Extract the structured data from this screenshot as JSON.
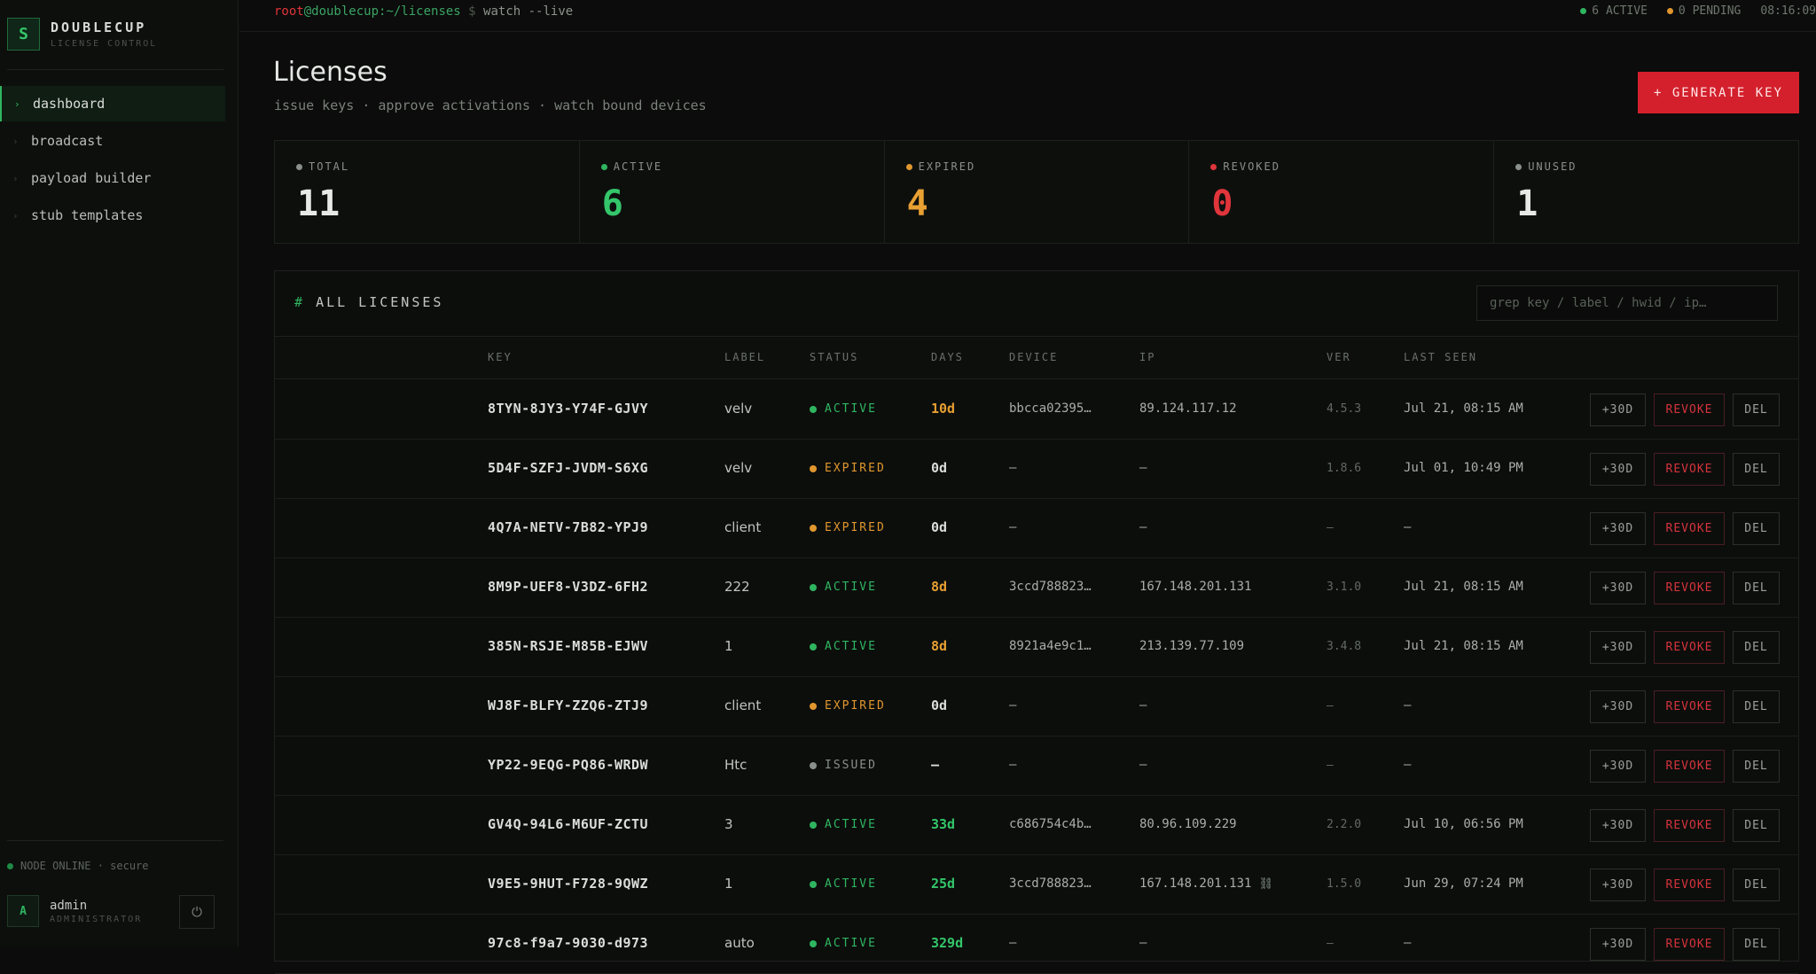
{
  "brand": {
    "logo": "S",
    "name": "DOUBLECUP",
    "sub": "LICENSE CONTROL"
  },
  "nav": [
    {
      "label": "dashboard",
      "active": true
    },
    {
      "label": "broadcast",
      "active": false
    },
    {
      "label": "payload builder",
      "active": false
    },
    {
      "label": "stub templates",
      "active": false
    }
  ],
  "node_status": "NODE ONLINE · secure",
  "user": {
    "initial": "A",
    "name": "admin",
    "role": "ADMINISTRATOR",
    "logout_icon": "power-icon"
  },
  "topbar": {
    "cmd_user": "root",
    "cmd_host": "@doublecup",
    "cmd_path": ":~/licenses",
    "cmd_prompt": " $ ",
    "cmd_text": "watch --live",
    "active_count": "6 ACTIVE",
    "pending_count": "0 PENDING",
    "clock": "08:16:09"
  },
  "page": {
    "title": "Licenses",
    "subtitle": "issue keys · approve activations · watch bound devices",
    "generate_label": "+ GENERATE KEY"
  },
  "stats": [
    {
      "label": "TOTAL",
      "value": "11",
      "dot": "#8a908a",
      "color": "#e6e9e6"
    },
    {
      "label": "ACTIVE",
      "value": "6",
      "dot": "#2fb560",
      "color": "#34c66a"
    },
    {
      "label": "EXPIRED",
      "value": "4",
      "dot": "#e0972e",
      "color": "#e8a032"
    },
    {
      "label": "REVOKED",
      "value": "0",
      "dot": "#e0353b",
      "color": "#e0353b"
    },
    {
      "label": "UNUSED",
      "value": "1",
      "dot": "#8a908a",
      "color": "#e6e9e6"
    }
  ],
  "table": {
    "title": "ALL LICENSES",
    "search_placeholder": "grep key / label / hwid / ip…",
    "headers": [
      "KEY",
      "LABEL",
      "STATUS",
      "DAYS",
      "DEVICE",
      "IP",
      "VER",
      "LAST SEEN"
    ],
    "action_labels": {
      "extend": "+30D",
      "revoke": "REVOKE",
      "del": "DEL"
    },
    "rows": [
      {
        "key": "8TYN-8JY3-Y74F-GJVY",
        "label": "velv",
        "status": "ACTIVE",
        "days": "10d",
        "device": "bbcca02395…",
        "ip": "89.124.117.12",
        "ver": "4.5.3",
        "last_seen": "Jul 21, 08:15 AM"
      },
      {
        "key": "5D4F-SZFJ-JVDM-S6XG",
        "label": "velv",
        "status": "EXPIRED",
        "days": "0d",
        "device": "—",
        "ip": "—",
        "ver": "1.8.6",
        "last_seen": "Jul 01, 10:49 PM"
      },
      {
        "key": "4Q7A-NETV-7B82-YPJ9",
        "label": "client",
        "status": "EXPIRED",
        "days": "0d",
        "device": "—",
        "ip": "—",
        "ver": "—",
        "last_seen": "—"
      },
      {
        "key": "8M9P-UEF8-V3DZ-6FH2",
        "label": "222",
        "status": "ACTIVE",
        "days": "8d",
        "device": "3ccd788823…",
        "ip": "167.148.201.131",
        "ver": "3.1.0",
        "last_seen": "Jul 21, 08:15 AM"
      },
      {
        "key": "385N-RSJE-M85B-EJWV",
        "label": "1",
        "status": "ACTIVE",
        "days": "8d",
        "device": "8921a4e9c1…",
        "ip": "213.139.77.109",
        "ver": "3.4.8",
        "last_seen": "Jul 21, 08:15 AM"
      },
      {
        "key": "WJ8F-BLFY-ZZQ6-ZTJ9",
        "label": "client",
        "status": "EXPIRED",
        "days": "0d",
        "device": "—",
        "ip": "—",
        "ver": "—",
        "last_seen": "—"
      },
      {
        "key": "YP22-9EQG-PQ86-WRDW",
        "label": "Htc",
        "status": "ISSUED",
        "days": "—",
        "device": "—",
        "ip": "—",
        "ver": "—",
        "last_seen": "—"
      },
      {
        "key": "GV4Q-94L6-M6UF-ZCTU",
        "label": "3",
        "status": "ACTIVE",
        "days": "33d",
        "device": "c686754c4b…",
        "ip": "80.96.109.229",
        "ver": "2.2.0",
        "last_seen": "Jul 10, 06:56 PM"
      },
      {
        "key": "V9E5-9HUT-F728-9QWZ",
        "label": "1",
        "status": "ACTIVE",
        "days": "25d",
        "device": "3ccd788823…",
        "ip": "167.148.201.131",
        "ip_icon": "link-icon",
        "ver": "1.5.0",
        "last_seen": "Jun 29, 07:24 PM"
      },
      {
        "key": "97c8-f9a7-9030-d973",
        "label": "auto",
        "status": "ACTIVE",
        "days": "329d",
        "device": "—",
        "ip": "—",
        "ver": "—",
        "last_seen": "—"
      }
    ]
  },
  "colors": {
    "accent_green": "#2fb560",
    "accent_red": "#d3202c",
    "expired_orange": "#e0972e",
    "issued_gray": "#8a908a"
  }
}
